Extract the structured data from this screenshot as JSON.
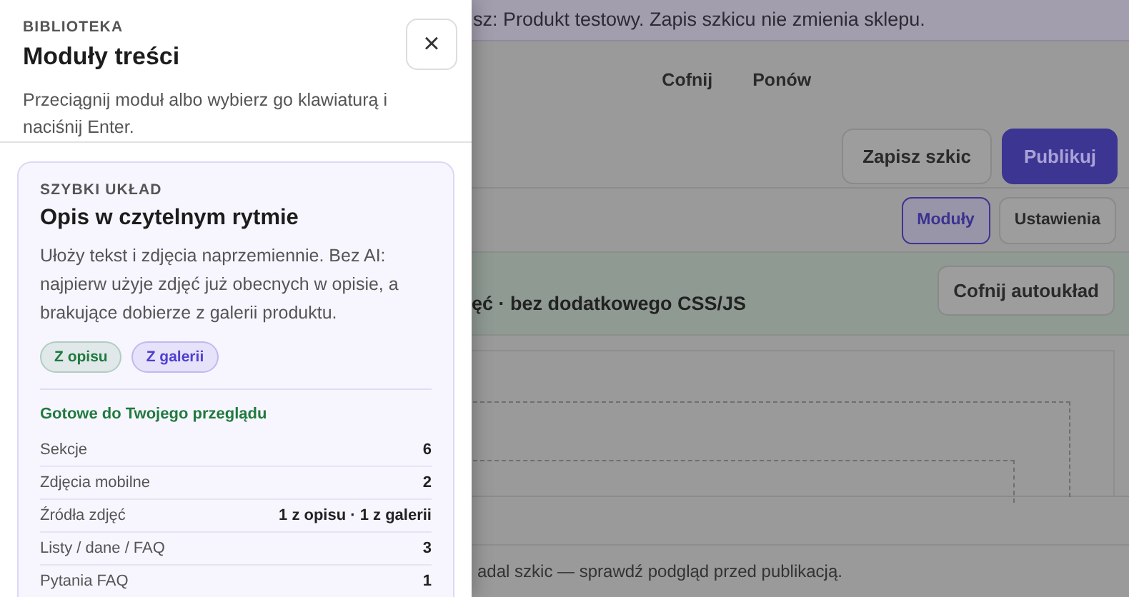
{
  "page": {
    "banner": "sz: Produkt testowy. Zapis szkicu nie zmienia sklepu.",
    "history": [
      "Cofnij",
      "Ponów"
    ],
    "actions": [
      {
        "label": "Zapisz szkic",
        "kind": "secondary"
      },
      {
        "label": "Publikuj",
        "kind": "primary"
      }
    ],
    "tabs": [
      {
        "label": "Moduły",
        "selected": true
      },
      {
        "label": "Ustawienia",
        "selected": false
      }
    ],
    "autolayout": {
      "text": "ęć · bez dodatkowego CSS/JS",
      "button": "Cofnij autoukład"
    },
    "footer": "adal szkic — sprawdź podgląd przed publikacją."
  },
  "drawer": {
    "eyebrow": "BIBLIOTEKA",
    "title": "Moduły treści",
    "close": "×",
    "description": "Przeciągnij moduł albo wybierz go klawiaturą i naciśnij Enter.",
    "card": {
      "eyebrow": "SZYBKI UKŁAD",
      "title": "Opis w czytelnym rytmie",
      "description": "Ułoży tekst i zdjęcia naprzemiennie. Bez AI: najpierw użyje zdjęć już obecnych w opisie, a brakujące dobierze z galerii produktu.",
      "tags": [
        {
          "label": "Z opisu",
          "color": "#1f7a3e"
        },
        {
          "label": "Z galerii",
          "color": "#4f3fd0"
        }
      ],
      "summary_title": "Gotowe do Twojego przeglądu",
      "summary": [
        {
          "label": "Sekcje",
          "value": "6"
        },
        {
          "label": "Zdjęcia mobilne",
          "value": "2"
        },
        {
          "label": "Źródła zdjęć",
          "value": "1 z opisu · 1 z galerii"
        },
        {
          "label": "Listy / dane / FAQ",
          "value": "3"
        },
        {
          "label": "Pytania FAQ",
          "value": "1"
        }
      ]
    }
  }
}
